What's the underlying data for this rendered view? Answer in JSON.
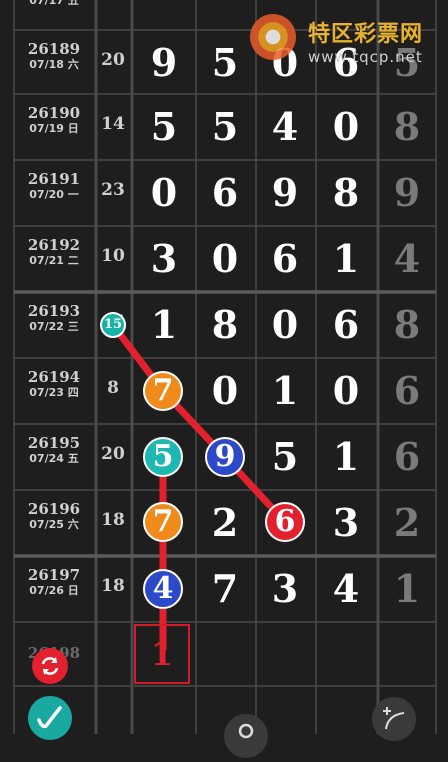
{
  "watermark": {
    "cn": "特区彩票网",
    "url": "www.tqcp.net"
  },
  "top_partial": {
    "issue": "07/17 五"
  },
  "rows": [
    {
      "issue": "26189",
      "date": "07/18 六",
      "sum": "20",
      "digits": [
        "9",
        "5",
        "0",
        "6"
      ],
      "last": "5"
    },
    {
      "issue": "26190",
      "date": "07/19 日",
      "sum": "14",
      "digits": [
        "5",
        "5",
        "4",
        "0"
      ],
      "last": "8"
    },
    {
      "issue": "26191",
      "date": "07/20 一",
      "sum": "23",
      "digits": [
        "0",
        "6",
        "9",
        "8"
      ],
      "last": "9"
    },
    {
      "issue": "26192",
      "date": "07/21 二",
      "sum": "10",
      "digits": [
        "3",
        "0",
        "6",
        "1"
      ],
      "last": "4"
    },
    {
      "issue": "26193",
      "date": "07/22 三",
      "sum": "15",
      "digits": [
        "1",
        "8",
        "0",
        "6"
      ],
      "last": "8"
    },
    {
      "issue": "26194",
      "date": "07/23 四",
      "sum": "8",
      "digits": [
        "7",
        "0",
        "1",
        "0"
      ],
      "last": "6"
    },
    {
      "issue": "26195",
      "date": "07/24 五",
      "sum": "20",
      "digits": [
        "5",
        "9",
        "5",
        "1"
      ],
      "last": "6"
    },
    {
      "issue": "26196",
      "date": "07/25 六",
      "sum": "18",
      "digits": [
        "7",
        "2",
        "6",
        "3"
      ],
      "last": "2"
    },
    {
      "issue": "26197",
      "date": "07/26 日",
      "sum": "18",
      "digits": [
        "4",
        "7",
        "3",
        "4"
      ],
      "last": "1"
    }
  ],
  "next_issue_partial": "26198",
  "prediction": "1",
  "balls": [
    {
      "label": "15",
      "color": "#17b3a8"
    },
    {
      "label": "7",
      "color": "#f08a1a"
    },
    {
      "label": "5",
      "color": "#1fb8b0"
    },
    {
      "label": "9",
      "color": "#2b49c9"
    },
    {
      "label": "7",
      "color": "#f08a1a"
    },
    {
      "label": "6",
      "color": "#e3202e"
    },
    {
      "label": "4",
      "color": "#2b49c9"
    }
  ],
  "colors": {
    "background": "#1e1e1e",
    "grid": "#4a4a4a",
    "trend_line": "#e3202e",
    "accent_red": "#e3202e"
  },
  "icons": [
    "refresh-icon",
    "pen-icon",
    "search-icon",
    "curve-draw-icon"
  ]
}
